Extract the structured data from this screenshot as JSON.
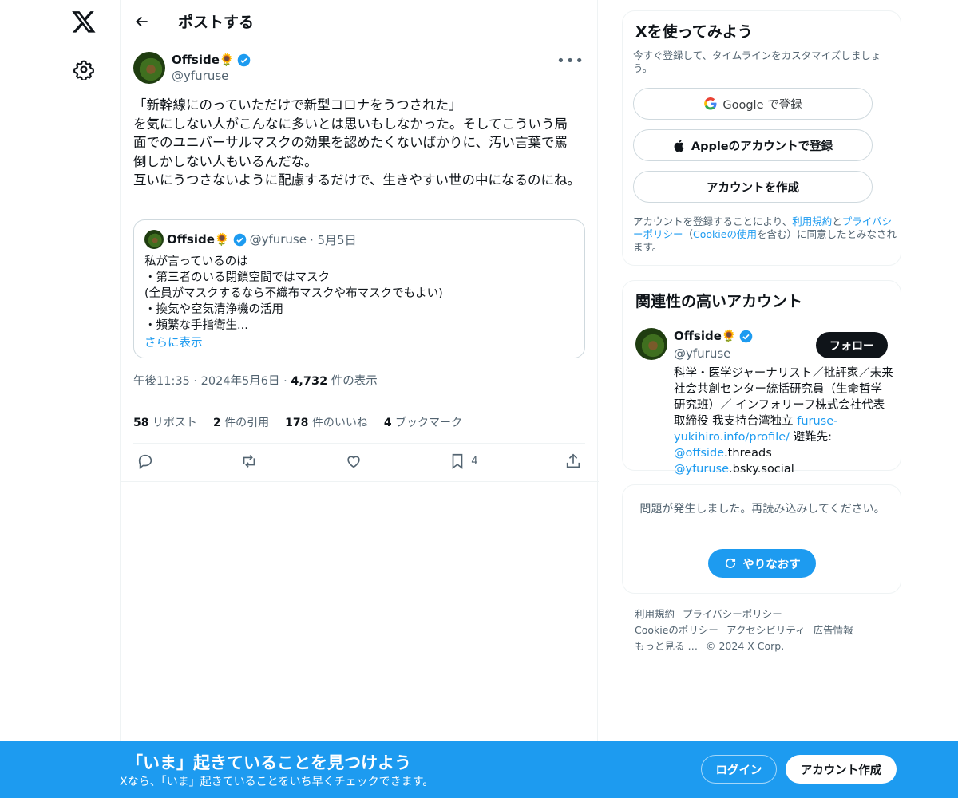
{
  "nav": {
    "logo": "x-logo",
    "settings": "gear-icon"
  },
  "header": {
    "title": "ポストする"
  },
  "post": {
    "display_name": "Offside🌻",
    "handle": "@yfuruse",
    "body": "「新幹線にのっていただけで新型コロナをうつされた」\nを気にしない人がこんなに多いとは思いもしなかった。そしてこういう局面でのユニバーサルマスクの効果を認めたくないばかりに、汚い言葉で罵倒しかしない人もいるんだな。\n互いにうつさないように配慮するだけで、生きやすい世の中になるのにね。",
    "quote": {
      "display_name": "Offside🌻",
      "handle": "@yfuruse",
      "date": "· 5月5日",
      "text": "私が言っているのは\n・第三者のいる閉鎖空間ではマスク\n(全員がマスクするなら不織布マスクや布マスクでもよい)\n・換気や空気清浄機の活用\n・頻繁な手指衛生...",
      "show_more": "さらに表示"
    },
    "meta": {
      "time": "午後11:35 · 2024年5月6日 · ",
      "views": "4,732",
      "views_label": " 件の表示"
    },
    "stats": {
      "reposts": "58",
      "reposts_label": " リポスト",
      "quotes": "2",
      "quotes_label": " 件の引用",
      "likes": "178",
      "likes_label": " 件のいいね",
      "bookmarks": "4",
      "bookmarks_label": " ブックマーク"
    },
    "actions": {
      "bookmark_count": "4"
    }
  },
  "signup_card": {
    "title": "Xを使ってみよう",
    "subtitle": "今すぐ登録して、タイムラインをカスタマイズしましょう。",
    "google": "Google で登録",
    "apple": "Appleのアカウントで登録",
    "create": "アカウントを作成",
    "terms_a": "アカウントを登録することにより、",
    "terms_tos": "利用規約",
    "terms_b": "と",
    "terms_pp": "プライバシーポリシー",
    "terms_c": "（",
    "terms_cookie": "Cookieの使用",
    "terms_d": "を含む）に同意したとみなされます。"
  },
  "relevant": {
    "title": "関連性の高いアカウント",
    "display_name": "Offside🌻",
    "handle": "@yfuruse",
    "follow": "フォロー",
    "bio_a": "科学・医学ジャーナリスト／批評家／未来社会共創センター統括研究員（生命哲学研究班）／ インフォリーフ株式会社代表取締役 我支持台湾独立 ",
    "bio_link": "furuse-yukihiro.info/profile/",
    "bio_b": " 避難先: ",
    "bio_m1": "@offside",
    "bio_c": ".threads ",
    "bio_m2": "@yfuruse",
    "bio_d": ".bsky.social"
  },
  "error_card": {
    "message": "問題が発生しました。再読み込みしてください。",
    "retry": "やりなおす"
  },
  "footer": {
    "links": [
      "利用規約",
      "プライバシーポリシー",
      "Cookieのポリシー",
      "アクセシビリティ",
      "広告情報",
      "もっと見る …",
      "© 2024 X Corp."
    ]
  },
  "bottom_bar": {
    "title": "「いま」起きていることを見つけよう",
    "subtitle": "Xなら、「いま」起きていることをいち早くチェックできます。",
    "login": "ログイン",
    "signup": "アカウント作成"
  },
  "colors": {
    "accent": "#1d9bf0",
    "text": "#0f1419",
    "muted": "#536471",
    "border": "#eff3f4"
  }
}
